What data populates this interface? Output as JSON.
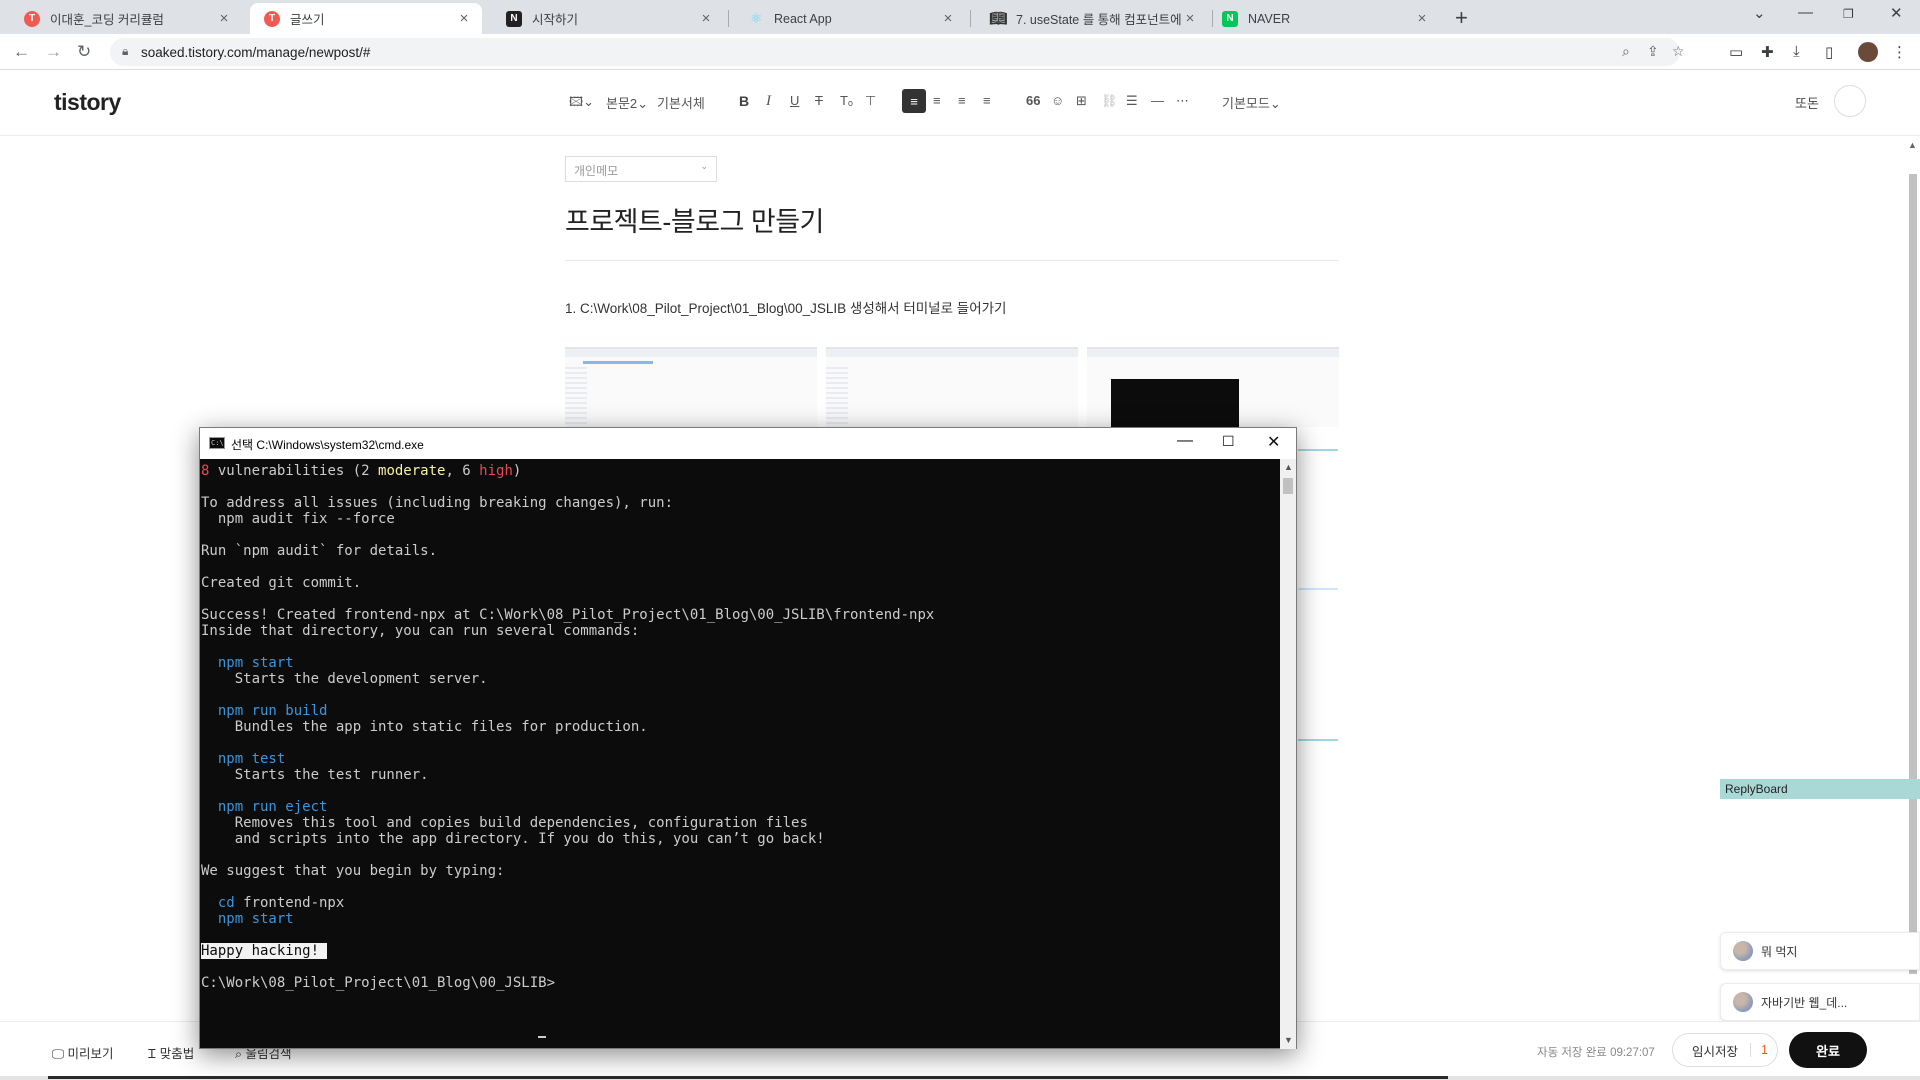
{
  "browser": {
    "tabs": [
      {
        "title": "이대훈_코딩 커리큘럼",
        "favicon": "T",
        "favicon_color": "#f15a52",
        "active": false
      },
      {
        "title": "글쓰기",
        "favicon": "T",
        "favicon_color": "#f15a52",
        "active": true
      },
      {
        "title": "시작하기",
        "favicon": "N",
        "favicon_color": "#222222",
        "active": false
      },
      {
        "title": "React App",
        "favicon": "react-icon",
        "favicon_color": "#61dafb",
        "active": false
      },
      {
        "title": "7. useState 를 통해 컴포넌트에",
        "favicon": "book-icon",
        "favicon_color": "#333333",
        "active": false
      },
      {
        "title": "NAVER",
        "favicon": "N",
        "favicon_color": "#03c75a",
        "active": false
      }
    ],
    "url": "soaked.tistory.com/manage/newpost/#"
  },
  "editor": {
    "logo": "tistory",
    "toolbar": {
      "style_select": "본문2",
      "font_select": "기본서체",
      "mode_select": "기본모드",
      "sidemenu": "또돈"
    },
    "category": "개인메모",
    "title": "프로젝트-블로그 만들기",
    "content_line": "1. C:\\Work\\08_Pilot_Project\\01_Blog\\00_JSLIB 생성해서 터미널로 들어가기"
  },
  "side": {
    "replyboard": "ReplyBoard",
    "items": [
      "뭐 먹지",
      "자바기반 웹_데..."
    ]
  },
  "bottom": {
    "preview": "미리보기",
    "spellcheck": "맞춤법",
    "embed": "울림검색",
    "autosave": "자동 저장 완료 09:27:07",
    "draft": "임시저장",
    "draft_count": "1",
    "done": "완료"
  },
  "cmd": {
    "title": "선택 C:\\Windows\\system32\\cmd.exe",
    "lines": [
      [
        {
          "t": "8",
          "c": "red"
        },
        {
          "t": " vulnerabilities (2 "
        },
        {
          "t": "moderate",
          "c": "yel"
        },
        {
          "t": ", 6 "
        },
        {
          "t": "high",
          "c": "red"
        },
        {
          "t": ")"
        }
      ],
      [],
      [
        {
          "t": "To address all issues (including breaking changes), run:"
        }
      ],
      [
        {
          "t": "  npm audit fix --force"
        }
      ],
      [],
      [
        {
          "t": "Run `npm audit` for details."
        }
      ],
      [],
      [
        {
          "t": "Created git commit."
        }
      ],
      [],
      [
        {
          "t": "Success! Created frontend-npx at C:\\Work\\08_Pilot_Project\\01_Blog\\00_JSLIB\\frontend-npx"
        }
      ],
      [
        {
          "t": "Inside that directory, you can run several commands:"
        }
      ],
      [],
      [
        {
          "t": "  "
        },
        {
          "t": "npm start",
          "c": "blue"
        }
      ],
      [
        {
          "t": "    Starts the development server."
        }
      ],
      [],
      [
        {
          "t": "  "
        },
        {
          "t": "npm run build",
          "c": "blue"
        }
      ],
      [
        {
          "t": "    Bundles the app into static files for production."
        }
      ],
      [],
      [
        {
          "t": "  "
        },
        {
          "t": "npm test",
          "c": "blue"
        }
      ],
      [
        {
          "t": "    Starts the test runner."
        }
      ],
      [],
      [
        {
          "t": "  "
        },
        {
          "t": "npm run eject",
          "c": "blue"
        }
      ],
      [
        {
          "t": "    Removes this tool and copies build dependencies, configuration files"
        }
      ],
      [
        {
          "t": "    and scripts into the app directory. If you do this, you can’t go back!"
        }
      ],
      [],
      [
        {
          "t": "We suggest that you begin by typing:"
        }
      ],
      [],
      [
        {
          "t": "  "
        },
        {
          "t": "cd",
          "c": "blue"
        },
        {
          "t": " frontend-npx"
        }
      ],
      [
        {
          "t": "  "
        },
        {
          "t": "npm start",
          "c": "blue"
        }
      ],
      [],
      [
        {
          "t": "Happy hacking! ",
          "c": "inv"
        }
      ],
      [],
      [
        {
          "t": "C:\\Work\\08_Pilot_Project\\01_Blog\\00_JSLIB>"
        }
      ]
    ]
  }
}
